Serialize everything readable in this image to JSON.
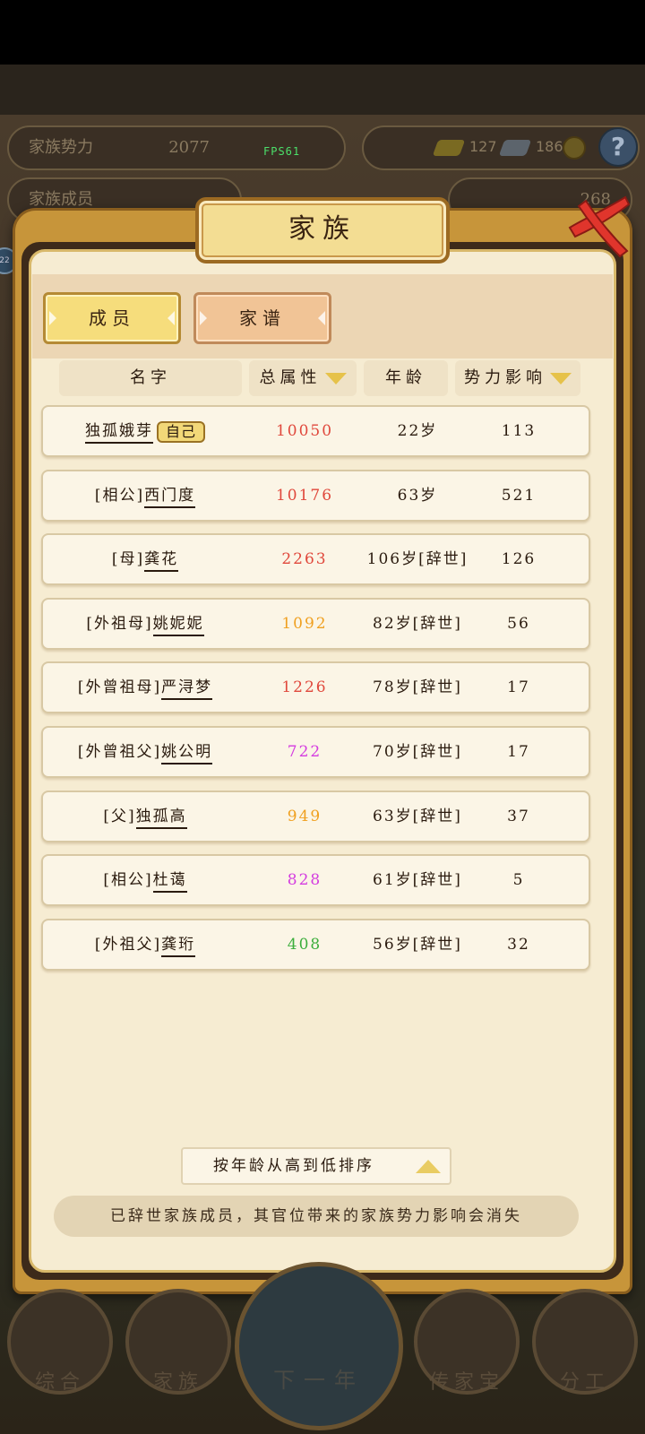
{
  "hud": {
    "clan_power_label": "家族势力",
    "clan_power_value": "2077",
    "fps": "FPS61",
    "clan_members_label": "家族成员",
    "gold_count": "127",
    "silver_count": "186",
    "ingot_count": "268",
    "help_label": "?",
    "level": "22"
  },
  "dialog": {
    "title": "家族",
    "tabs": [
      {
        "label": "成员",
        "active": true
      },
      {
        "label": "家谱",
        "active": false
      }
    ],
    "columns": [
      "名字",
      "总属性",
      "年龄",
      "势力影响"
    ],
    "self_badge": "自己",
    "rows": [
      {
        "relation": "",
        "name": "独孤娥芽",
        "is_self": true,
        "attr": "10050",
        "attr_color": "#e0483c",
        "age": "22岁",
        "inf": "113"
      },
      {
        "relation": "[相公]",
        "name": "西门度",
        "is_self": false,
        "attr": "10176",
        "attr_color": "#e0483c",
        "age": "63岁",
        "inf": "521"
      },
      {
        "relation": "[母]",
        "name": "龚花",
        "is_self": false,
        "attr": "2263",
        "attr_color": "#e0483c",
        "age": "106岁[辞世]",
        "inf": "126"
      },
      {
        "relation": "[外祖母]",
        "name": "姚妮妮",
        "is_self": false,
        "attr": "1092",
        "attr_color": "#f0a020",
        "age": "82岁[辞世]",
        "inf": "56"
      },
      {
        "relation": "[外曾祖母]",
        "name": "严浔梦",
        "is_self": false,
        "attr": "1226",
        "attr_color": "#e0483c",
        "age": "78岁[辞世]",
        "inf": "17"
      },
      {
        "relation": "[外曾祖父]",
        "name": "姚公明",
        "is_self": false,
        "attr": "722",
        "attr_color": "#d43ce0",
        "age": "70岁[辞世]",
        "inf": "17"
      },
      {
        "relation": "[父]",
        "name": "独孤高",
        "is_self": false,
        "attr": "949",
        "attr_color": "#f0a020",
        "age": "63岁[辞世]",
        "inf": "37"
      },
      {
        "relation": "[相公]",
        "name": "杜蔼",
        "is_self": false,
        "attr": "828",
        "attr_color": "#d43ce0",
        "age": "61岁[辞世]",
        "inf": "5"
      },
      {
        "relation": "[外祖父]",
        "name": "龚珩",
        "is_self": false,
        "attr": "408",
        "attr_color": "#3cae3c",
        "age": "56岁[辞世]",
        "inf": "32"
      }
    ],
    "sort_button": "按年龄从高到低排序",
    "notice": "已辞世家族成员，其官位带来的家族势力影响会消失"
  },
  "nav": {
    "items": [
      "综合",
      "家族",
      "下一年",
      "传家宝",
      "分工"
    ]
  },
  "colors": {
    "frame_gold": "#c7953a",
    "panel_cream": "#f6ecd2",
    "tab_active": "#f6dd7c",
    "tab_inactive": "#f1c496"
  }
}
